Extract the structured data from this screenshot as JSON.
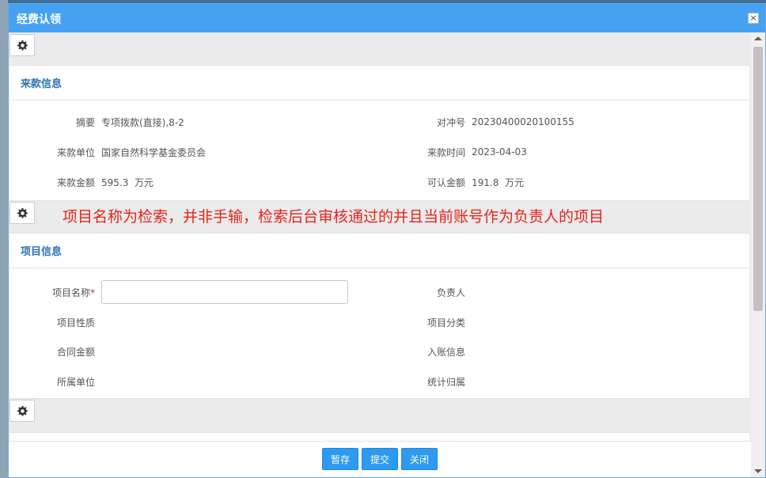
{
  "dialog": {
    "title": "经费认领",
    "close_glyph": "×"
  },
  "icons": {
    "toolbar": "gear-icon",
    "close": "close-icon"
  },
  "colors": {
    "titlebar": "#45a2f3",
    "section_title": "#2f73b3",
    "annotation": "#e8231a",
    "button": "#2d9af0",
    "required": "#e02020"
  },
  "income": {
    "section_title": "来款信息",
    "fields": {
      "summary": {
        "label": "摘要",
        "value": "专项拨款(直接),8-2"
      },
      "reconcile_no": {
        "label": "对冲号",
        "value": "20230400020100155"
      },
      "payer": {
        "label": "来款单位",
        "value": "国家自然科学基金委员会"
      },
      "pay_time": {
        "label": "来款时间",
        "value": "2023-04-03"
      },
      "amount": {
        "label": "来款金额",
        "value": "595.3  万元"
      },
      "claimable": {
        "label": "可认金额",
        "value": "191.8  万元"
      }
    }
  },
  "annotation": "项目名称为检索，并非手输，检索后台审核通过的并且当前账号作为负责人的项目",
  "project": {
    "section_title": "项目信息",
    "name_label": "项目名称",
    "required_mark": "*",
    "name_value": "",
    "name_placeholder": "",
    "leader_label": "负责人",
    "nature_label": "项目性质",
    "category_label": "项目分类",
    "contract_amount_label": "合同金额",
    "account_info_label": "入账信息",
    "dept_label": "所属单位",
    "stat_label": "统计归属"
  },
  "footer": {
    "save_draft": "暂存",
    "submit": "提交",
    "close": "关闭"
  }
}
